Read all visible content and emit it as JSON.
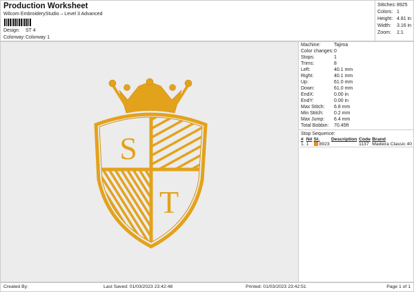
{
  "header": {
    "title": "Production Worksheet",
    "subtitle": "Wilcom EmbroideryStudio – Level 3 Advanced",
    "design_label": "Design:",
    "design_value": "ST 4",
    "colorway_label": "Colorway:",
    "colorway_value": "Colorway 1"
  },
  "stats": [
    {
      "k": "Stitches:",
      "v": "8925"
    },
    {
      "k": "Colors:",
      "v": "1"
    },
    {
      "k": "Height:",
      "v": "4.81 in"
    },
    {
      "k": "Width:",
      "v": "3.16 in"
    },
    {
      "k": "Zoom:",
      "v": "1:1"
    }
  ],
  "machine": [
    {
      "k": "Machine:",
      "v": "Tajima"
    },
    {
      "k": "Color changes:",
      "v": "0"
    },
    {
      "k": "Stops:",
      "v": "1"
    },
    {
      "k": "Trims:",
      "v": "8"
    },
    {
      "k": "Left:",
      "v": "40.1 mm"
    },
    {
      "k": "Right:",
      "v": "40.1 mm"
    },
    {
      "k": "Up:",
      "v": "61.0 mm"
    },
    {
      "k": "Down:",
      "v": "61.0 mm"
    },
    {
      "k": "EndX:",
      "v": "0.00 in"
    },
    {
      "k": "EndY:",
      "v": "0.00 in"
    },
    {
      "k": "Max Stitch:",
      "v": "6.8 mm"
    },
    {
      "k": "Min Stitch:",
      "v": "0.2 mm"
    },
    {
      "k": "Max Jump:",
      "v": "6.4 mm"
    },
    {
      "k": "Total Bobbin:",
      "v": "70.45ft"
    }
  ],
  "stop_sequence": {
    "title": "Stop Sequence:",
    "headers": [
      "#",
      "N#",
      "St.",
      "Description",
      "Code",
      "Brand"
    ],
    "rows": [
      {
        "num": "1.",
        "n": "1",
        "st": "8923",
        "desc": "",
        "code": "1137",
        "brand": "Madeira Classic 40",
        "color": "#e8901c"
      }
    ]
  },
  "design": {
    "letters": [
      "S",
      "T"
    ],
    "thread_color": "#e3a21c"
  },
  "footer": {
    "created": "Created By:",
    "saved": "Last Saved: 01/03/2023 23:42:48",
    "printed": "Printed: 01/03/2023 23:42:51",
    "page": "Page 1 of 1"
  }
}
